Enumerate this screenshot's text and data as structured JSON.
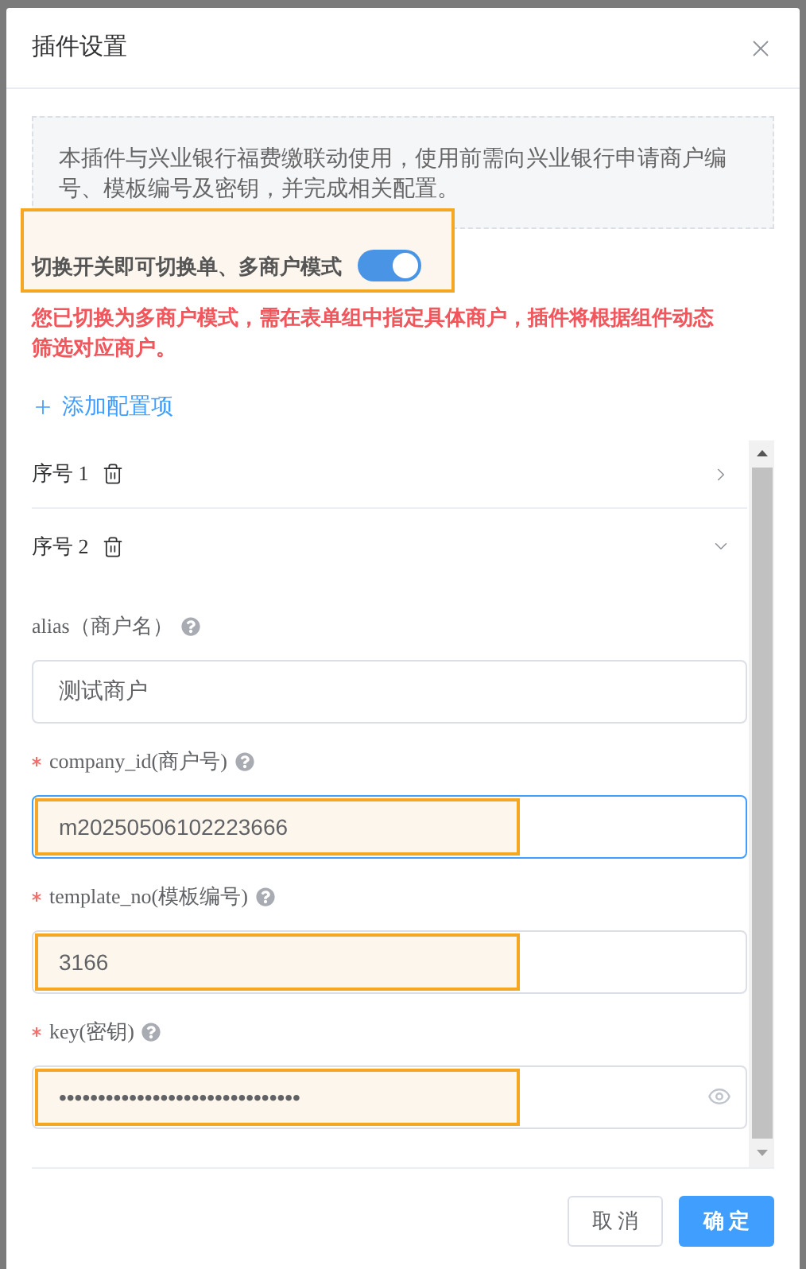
{
  "dialog": {
    "title": "插件设置"
  },
  "notice": "本插件与兴业银行福费缴联动使用，使用前需向兴业银行申请商户编号、模板编号及密钥，并完成相关配置。",
  "mode_switch": {
    "label": "切换开关即可切换单、多商户模式",
    "on": true,
    "highlighted": true
  },
  "warning": "您已切换为多商户模式，需在表单组中指定具体商户，插件将根据组件动态筛选对应商户。",
  "add_link": "添加配置项",
  "items": [
    {
      "label": "序号 1",
      "expanded": false
    },
    {
      "label": "序号 2",
      "expanded": true,
      "fields": [
        {
          "label": "alias（商户名）",
          "required": false,
          "value": "测试商户",
          "focused": false,
          "highlighted": false,
          "kind": "text"
        },
        {
          "label": "company_id(商户号)",
          "required": true,
          "value": "m20250506102223666",
          "focused": true,
          "highlighted": true,
          "kind": "text"
        },
        {
          "label": "template_no(模板编号)",
          "required": true,
          "value": "3166",
          "focused": false,
          "highlighted": true,
          "kind": "text"
        },
        {
          "label": "key(密钥)",
          "required": true,
          "value": "•••••••••••••••••••••••••••••••",
          "focused": false,
          "highlighted": true,
          "kind": "password"
        }
      ]
    }
  ],
  "buttons": [
    {
      "label": "取消",
      "kind": "secondary"
    },
    {
      "label": "确定",
      "kind": "primary"
    }
  ]
}
